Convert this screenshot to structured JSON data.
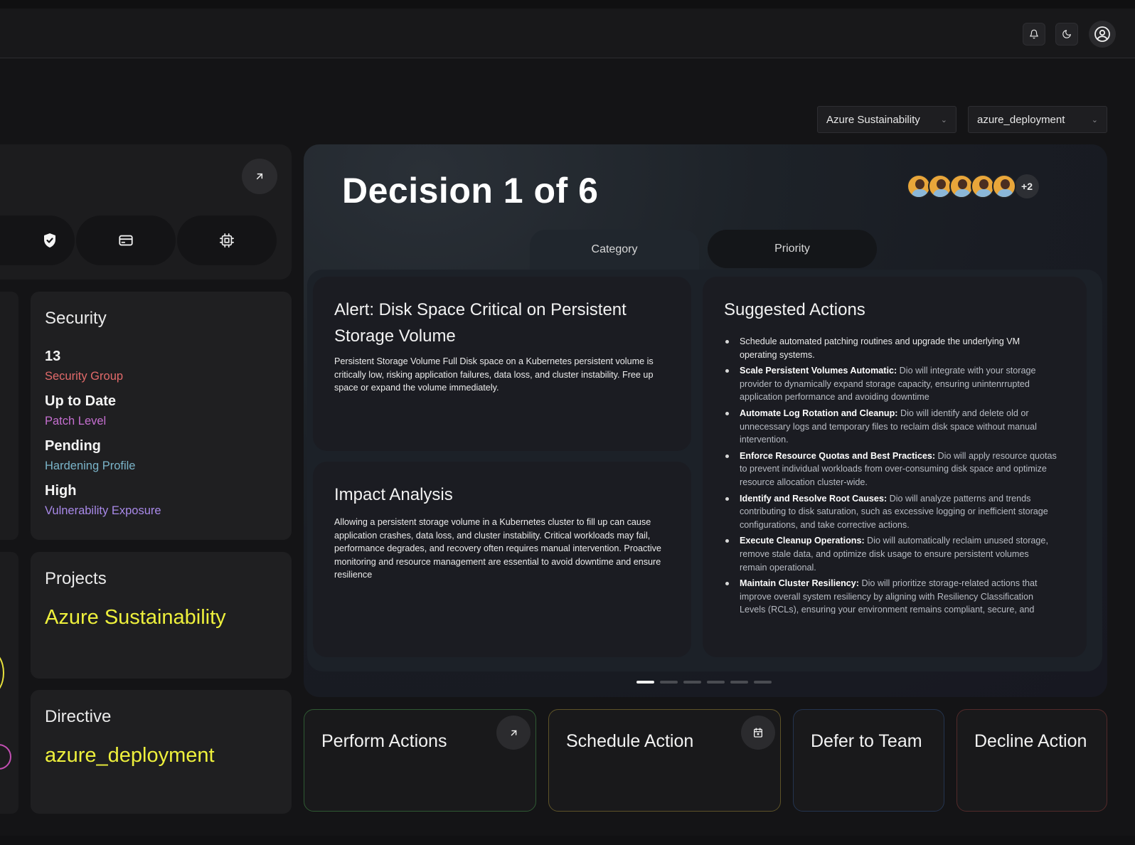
{
  "header": {
    "bell_icon": "bell-icon",
    "theme_icon": "moon-icon",
    "profile_icon": "user-circle-icon"
  },
  "filters": {
    "project_select": "Azure Sustainability",
    "directive_select": "azure_deployment"
  },
  "left": {
    "category_icons": [
      "shield-check-icon",
      "credit-card-icon",
      "cpu-chip-icon"
    ],
    "security": {
      "title": "Security",
      "items": [
        {
          "value": "13",
          "label": "Security Group",
          "color": "#e26a6a"
        },
        {
          "value": "Up to Date",
          "label": "Patch Level",
          "color": "#c56fd0"
        },
        {
          "value": "Pending",
          "label": "Hardening Profile",
          "color": "#7ab4c9"
        },
        {
          "value": "High",
          "label": "Vulnerability Exposure",
          "color": "#a889e8"
        }
      ]
    },
    "projects": {
      "title": "Projects",
      "value": "Azure Sustainability"
    },
    "directive": {
      "title": "Directive",
      "value": "azure_deployment"
    }
  },
  "decision": {
    "title": "Decision 1 of 6",
    "avatars_more": "+2",
    "tabs": [
      {
        "label": "Category",
        "active": true
      },
      {
        "label": "Priority",
        "active": false
      }
    ],
    "alert": {
      "title": "Alert: Disk Space Critical on Persistent Storage Volume",
      "body": "Persistent Storage Volume Full Disk space on a Kubernetes persistent volume is critically low, risking application failures, data loss, and cluster instability. Free up space or expand the volume immediately."
    },
    "impact": {
      "title": "Impact Analysis",
      "body": "Allowing a persistent storage volume in a Kubernetes cluster to fill up can cause application crashes, data loss, and cluster instability. Critical workloads may fail, performance degrades, and recovery often requires manual intervention. Proactive monitoring and resource management are essential to avoid downtime and ensure resilience"
    },
    "suggested": {
      "title": "Suggested Actions",
      "items": [
        {
          "bold": "",
          "text": "Schedule automated patching routines and upgrade the underlying VM operating systems."
        },
        {
          "bold": "Scale Persistent Volumes Automatic:",
          "text": " Dio will integrate with your storage provider to dynamically expand storage capacity, ensuring unintenrrupted application performance and avoiding downtime"
        },
        {
          "bold": "Automate Log Rotation and Cleanup:",
          "text": " Dio will identify and delete old or unnecessary logs and temporary files to reclaim disk space without manual intervention."
        },
        {
          "bold": "Enforce Resource Quotas and Best Practices:",
          "text": " Dio will apply resource quotas to prevent individual workloads from over-consuming disk space and optimize resource allocation cluster-wide."
        },
        {
          "bold": "Identify and Resolve Root Causes:",
          "text": " Dio will analyze patterns and trends contributing to disk saturation, such as excessive logging or inefficient storage configurations, and take corrective actions."
        },
        {
          "bold": "Execute Cleanup Operations:",
          "text": " Dio will automatically reclaim unused storage, remove stale data, and optimize disk usage to ensure persistent volumes remain operational."
        },
        {
          "bold": "Maintain Cluster Resiliency:",
          "text": " Dio will prioritize storage-related actions that improve overall system resiliency by aligning with Resiliency Classification Levels (RCLs), ensuring your environment remains compliant, secure, and"
        }
      ]
    },
    "pagination": {
      "total": 6,
      "current": 1
    }
  },
  "actions": [
    {
      "label": "Perform Actions",
      "icon": "arrow-up-right-icon",
      "border": "#2f5a33"
    },
    {
      "label": "Schedule Action",
      "icon": "calendar-icon",
      "border": "#5e5328"
    },
    {
      "label": "Defer to Team",
      "icon": "",
      "border": "#24344f"
    },
    {
      "label": "Decline Action",
      "icon": "",
      "border": "#532a2a"
    }
  ]
}
